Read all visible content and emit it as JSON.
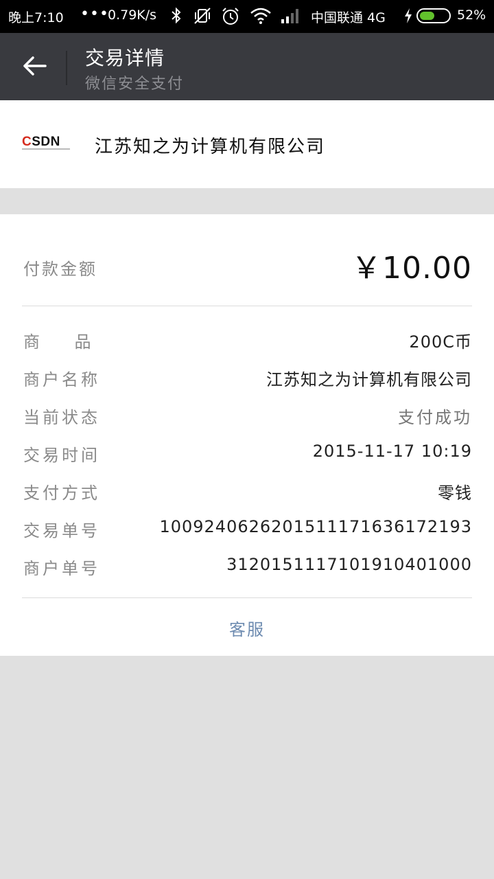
{
  "status_bar": {
    "time": "晚上7:10",
    "dots": "•••",
    "speed": "0.79K/s",
    "carrier": "中国联通 4G",
    "battery_percent": "52%",
    "battery_level": 0.52,
    "icons": [
      "bluetooth-icon",
      "vibrate-off-icon",
      "alarm-icon",
      "wifi-icon",
      "signal-icon",
      "charging-icon",
      "battery-icon"
    ]
  },
  "header": {
    "title": "交易详情",
    "subtitle": "微信安全支付"
  },
  "merchant": {
    "logo_text": "CSDN",
    "name": "江苏知之为计算机有限公司"
  },
  "payment": {
    "amount_label": "付款金额",
    "amount_value": "￥10.00"
  },
  "details": [
    {
      "label": "商    品",
      "value": "200C币"
    },
    {
      "label": "商户名称",
      "value": "江苏知之为计算机有限公司"
    },
    {
      "label": "当前状态",
      "value": "支付成功"
    },
    {
      "label": "交易时间",
      "value": "2015-11-17 10:19"
    },
    {
      "label": "支付方式",
      "value": "零钱"
    },
    {
      "label": "交易单号",
      "value": "1009240626201511171636172193"
    },
    {
      "label": "商户单号",
      "value": "3120151117101910401000"
    }
  ],
  "footer": {
    "service_label": "客服"
  },
  "colors": {
    "titlebar_bg": "#393a3f",
    "page_bg": "#e0e0e0",
    "link": "#6d8bb0",
    "logo_red": "#d52b1e",
    "battery_green": "#62c22c"
  }
}
